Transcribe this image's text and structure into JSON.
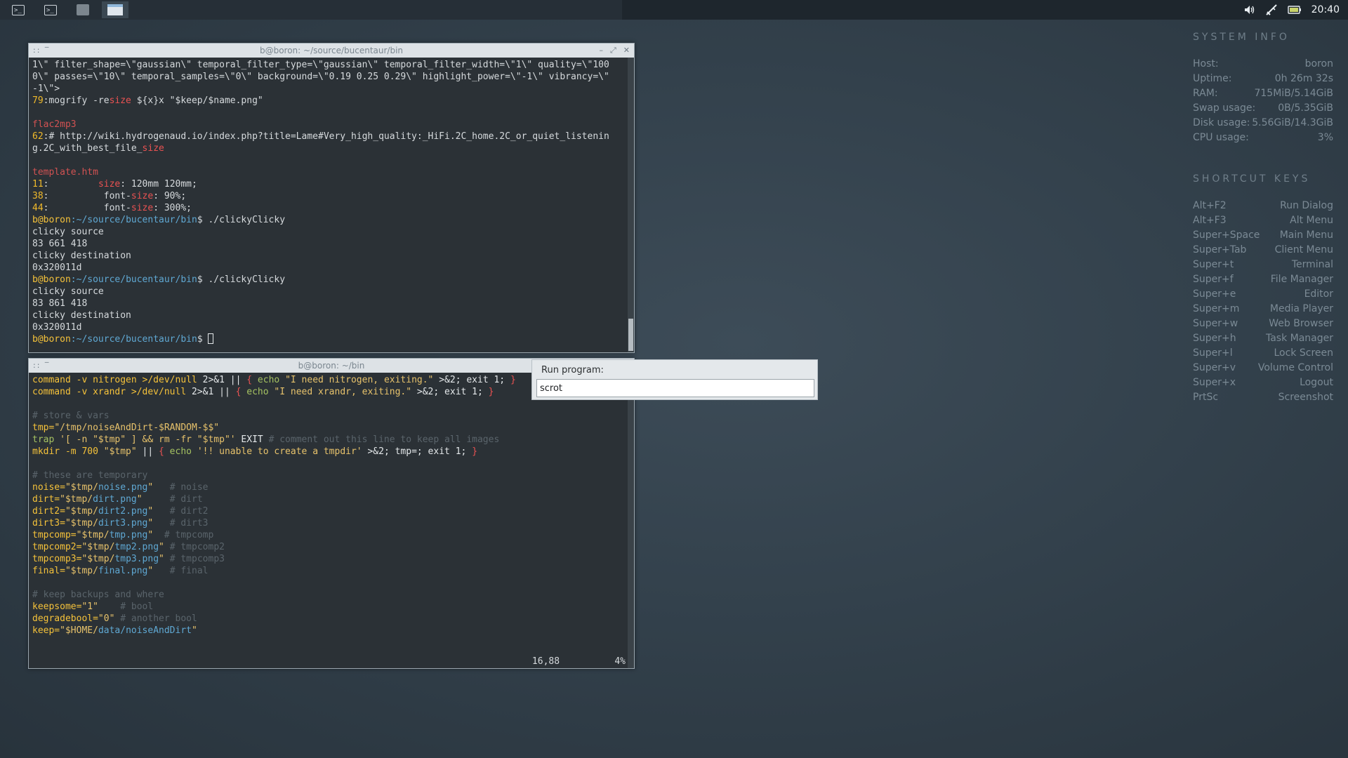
{
  "panel": {
    "taskbar_buttons": [
      {
        "name": "terminal-1",
        "glyph": ">_"
      },
      {
        "name": "terminal-2",
        "glyph": ">_"
      },
      {
        "name": "app-3",
        "glyph": ""
      },
      {
        "name": "window-4",
        "glyph": ""
      }
    ],
    "tray": {
      "volume_icon": "volume-icon",
      "network_icon": "network-icon",
      "battery_icon": "battery-icon",
      "clock": "20:40"
    }
  },
  "terminal_top": {
    "title": "b@boron: ~/source/bucentaur/bin",
    "lines": [
      {
        "segs": [
          {
            "t": "1\\\" filter_shape=\\\"gaussian\\\" temporal_filter_type=\\\"gaussian\\\" temporal_filter_width=\\\"1\\\" quality=\\\"100",
            "c": ""
          }
        ]
      },
      {
        "segs": [
          {
            "t": "0\\\" passes=\\\"10\\\" temporal_samples=\\\"0\\\" background=\\\"0.19 0.25 0.29\\\" highlight_power=\\\"-1\\\" vibrancy=\\\"",
            "c": ""
          }
        ]
      },
      {
        "segs": [
          {
            "t": "-1\\\">",
            "c": ""
          }
        ]
      },
      {
        "segs": [
          {
            "t": "79",
            "c": "c-ln"
          },
          {
            "t": ":mogrify -re",
            "c": ""
          },
          {
            "t": "size",
            "c": "c-hl"
          },
          {
            "t": " ${x}x \"$keep/$name.png\"",
            "c": ""
          }
        ]
      },
      {
        "segs": [
          {
            "t": " ",
            "c": ""
          }
        ]
      },
      {
        "segs": [
          {
            "t": "flac2mp3",
            "c": "c-file"
          }
        ]
      },
      {
        "segs": [
          {
            "t": "62",
            "c": "c-ln"
          },
          {
            "t": ":# http://wiki.hydrogenaud.io/index.php?title=Lame#Very_high_quality:_HiFi.2C_home.2C_or_quiet_listenin",
            "c": ""
          }
        ]
      },
      {
        "segs": [
          {
            "t": "g.2C_with_best_file_",
            "c": ""
          },
          {
            "t": "size",
            "c": "c-hl"
          }
        ]
      },
      {
        "segs": [
          {
            "t": " ",
            "c": ""
          }
        ]
      },
      {
        "segs": [
          {
            "t": "template.htm",
            "c": "c-file"
          }
        ]
      },
      {
        "segs": [
          {
            "t": "11",
            "c": "c-ln"
          },
          {
            "t": ":         ",
            "c": ""
          },
          {
            "t": "size",
            "c": "c-hl"
          },
          {
            "t": ": 120mm 120mm;",
            "c": ""
          }
        ]
      },
      {
        "segs": [
          {
            "t": "38",
            "c": "c-ln"
          },
          {
            "t": ":          font-",
            "c": ""
          },
          {
            "t": "size",
            "c": "c-hl"
          },
          {
            "t": ": 90%;",
            "c": ""
          }
        ]
      },
      {
        "segs": [
          {
            "t": "44",
            "c": "c-ln"
          },
          {
            "t": ":          font-",
            "c": ""
          },
          {
            "t": "size",
            "c": "c-hl"
          },
          {
            "t": ": 300%;",
            "c": ""
          }
        ]
      },
      {
        "segs": [
          {
            "t": "b@boron",
            "c": "c-user"
          },
          {
            "t": ":~/source/bucentaur/bin",
            "c": "c-path"
          },
          {
            "t": "$ ./clickyClicky",
            "c": ""
          }
        ]
      },
      {
        "segs": [
          {
            "t": "clicky source",
            "c": ""
          }
        ]
      },
      {
        "segs": [
          {
            "t": "83 661 418",
            "c": ""
          }
        ]
      },
      {
        "segs": [
          {
            "t": "clicky destination",
            "c": ""
          }
        ]
      },
      {
        "segs": [
          {
            "t": "0x320011d",
            "c": ""
          }
        ]
      },
      {
        "segs": [
          {
            "t": "b@boron",
            "c": "c-user"
          },
          {
            "t": ":~/source/bucentaur/bin",
            "c": "c-path"
          },
          {
            "t": "$ ./clickyClicky",
            "c": ""
          }
        ]
      },
      {
        "segs": [
          {
            "t": "clicky source",
            "c": ""
          }
        ]
      },
      {
        "segs": [
          {
            "t": "83 861 418",
            "c": ""
          }
        ]
      },
      {
        "segs": [
          {
            "t": "clicky destination",
            "c": ""
          }
        ]
      },
      {
        "segs": [
          {
            "t": "0x320011d",
            "c": ""
          }
        ]
      },
      {
        "segs": [
          {
            "t": "b@boron",
            "c": "c-user"
          },
          {
            "t": ":~/source/bucentaur/bin",
            "c": "c-path"
          },
          {
            "t": "$ ",
            "c": ""
          }
        ],
        "cursor": true
      }
    ]
  },
  "terminal_bottom": {
    "title": "b@boron: ~/bin",
    "lines": [
      {
        "segs": [
          {
            "t": "command -v nitrogen >/dev/null ",
            "c": "c-var"
          },
          {
            "t": "2>&1",
            "c": "c-white"
          },
          {
            "t": " || ",
            "c": "c-white"
          },
          {
            "t": "{",
            "c": "c-op"
          },
          {
            "t": " echo ",
            "c": "c-kw"
          },
          {
            "t": "\"I need nitrogen, exiting.\"",
            "c": "c-str"
          },
          {
            "t": " >&2; exit 1; ",
            "c": "c-white"
          },
          {
            "t": "}",
            "c": "c-op"
          }
        ]
      },
      {
        "segs": [
          {
            "t": "command -v xrandr >/dev/null ",
            "c": "c-var"
          },
          {
            "t": "2>&1",
            "c": "c-white"
          },
          {
            "t": " || ",
            "c": "c-white"
          },
          {
            "t": "{",
            "c": "c-op"
          },
          {
            "t": " echo ",
            "c": "c-kw"
          },
          {
            "t": "\"I need xrandr, exiting.\"",
            "c": "c-str"
          },
          {
            "t": " >&2; exit 1; ",
            "c": "c-white"
          },
          {
            "t": "}",
            "c": "c-op"
          }
        ]
      },
      {
        "segs": [
          {
            "t": " ",
            "c": ""
          }
        ]
      },
      {
        "segs": [
          {
            "t": "# store & vars",
            "c": "c-cmt"
          }
        ]
      },
      {
        "segs": [
          {
            "t": "tmp=",
            "c": "c-var"
          },
          {
            "t": "\"/tmp/noiseAndDirt-$RANDOM-$$\"",
            "c": "c-str"
          }
        ]
      },
      {
        "segs": [
          {
            "t": "trap ",
            "c": "c-kw"
          },
          {
            "t": "'[ -n \"$tmp\" ] && rm -fr \"$tmp\"'",
            "c": "c-str"
          },
          {
            "t": " EXIT ",
            "c": "c-white"
          },
          {
            "t": "# comment out this line to keep all images",
            "c": "c-cmt"
          }
        ]
      },
      {
        "segs": [
          {
            "t": "mkdir -m 700 ",
            "c": "c-var"
          },
          {
            "t": "\"$tmp\"",
            "c": "c-str"
          },
          {
            "t": " || ",
            "c": "c-white"
          },
          {
            "t": "{",
            "c": "c-op"
          },
          {
            "t": " echo ",
            "c": "c-kw"
          },
          {
            "t": "'!! unable to create a tmpdir'",
            "c": "c-str"
          },
          {
            "t": " >&2; tmp=; exit 1; ",
            "c": "c-white"
          },
          {
            "t": "}",
            "c": "c-op"
          }
        ]
      },
      {
        "segs": [
          {
            "t": " ",
            "c": ""
          }
        ]
      },
      {
        "segs": [
          {
            "t": "# these are temporary",
            "c": "c-cmt"
          }
        ]
      },
      {
        "segs": [
          {
            "t": "noise=",
            "c": "c-var"
          },
          {
            "t": "\"$tmp/",
            "c": "c-str"
          },
          {
            "t": "noise.png",
            "c": "c-blue"
          },
          {
            "t": "\"",
            "c": "c-str"
          },
          {
            "t": "   # noise",
            "c": "c-cmt"
          }
        ]
      },
      {
        "segs": [
          {
            "t": "dirt=",
            "c": "c-var"
          },
          {
            "t": "\"$tmp/",
            "c": "c-str"
          },
          {
            "t": "dirt.png",
            "c": "c-blue"
          },
          {
            "t": "\"",
            "c": "c-str"
          },
          {
            "t": "     # dirt",
            "c": "c-cmt"
          }
        ]
      },
      {
        "segs": [
          {
            "t": "dirt2=",
            "c": "c-var"
          },
          {
            "t": "\"$tmp/",
            "c": "c-str"
          },
          {
            "t": "dirt2.png",
            "c": "c-blue"
          },
          {
            "t": "\"",
            "c": "c-str"
          },
          {
            "t": "   # dirt2",
            "c": "c-cmt"
          }
        ]
      },
      {
        "segs": [
          {
            "t": "dirt3=",
            "c": "c-var"
          },
          {
            "t": "\"$tmp/",
            "c": "c-str"
          },
          {
            "t": "dirt3.png",
            "c": "c-blue"
          },
          {
            "t": "\"",
            "c": "c-str"
          },
          {
            "t": "   # dirt3",
            "c": "c-cmt"
          }
        ]
      },
      {
        "segs": [
          {
            "t": "tmpcomp=",
            "c": "c-var"
          },
          {
            "t": "\"$tmp/",
            "c": "c-str"
          },
          {
            "t": "tmp.png",
            "c": "c-blue"
          },
          {
            "t": "\"",
            "c": "c-str"
          },
          {
            "t": "  # tmpcomp",
            "c": "c-cmt"
          }
        ]
      },
      {
        "segs": [
          {
            "t": "tmpcomp2=",
            "c": "c-var"
          },
          {
            "t": "\"$tmp/",
            "c": "c-str"
          },
          {
            "t": "tmp2.png",
            "c": "c-blue"
          },
          {
            "t": "\"",
            "c": "c-str"
          },
          {
            "t": " # tmpcomp2",
            "c": "c-cmt"
          }
        ]
      },
      {
        "segs": [
          {
            "t": "tmpcomp3=",
            "c": "c-var"
          },
          {
            "t": "\"$tmp/",
            "c": "c-str"
          },
          {
            "t": "tmp3.png",
            "c": "c-blue"
          },
          {
            "t": "\"",
            "c": "c-str"
          },
          {
            "t": " # tmpcomp3",
            "c": "c-cmt"
          }
        ]
      },
      {
        "segs": [
          {
            "t": "final=",
            "c": "c-var"
          },
          {
            "t": "\"$tmp/",
            "c": "c-str"
          },
          {
            "t": "final.png",
            "c": "c-blue"
          },
          {
            "t": "\"",
            "c": "c-str"
          },
          {
            "t": "   # final",
            "c": "c-cmt"
          }
        ]
      },
      {
        "segs": [
          {
            "t": " ",
            "c": ""
          }
        ]
      },
      {
        "segs": [
          {
            "t": "# keep backups and where",
            "c": "c-cmt"
          }
        ]
      },
      {
        "segs": [
          {
            "t": "keepsome=",
            "c": "c-var"
          },
          {
            "t": "\"1\"",
            "c": "c-str"
          },
          {
            "t": "    # bool",
            "c": "c-cmt"
          }
        ]
      },
      {
        "segs": [
          {
            "t": "degradebool=",
            "c": "c-var"
          },
          {
            "t": "\"0\"",
            "c": "c-str"
          },
          {
            "t": " # another bool",
            "c": "c-cmt"
          }
        ]
      },
      {
        "segs": [
          {
            "t": "keep=",
            "c": "c-var"
          },
          {
            "t": "\"$HOME/",
            "c": "c-str"
          },
          {
            "t": "data/noiseAndDirt",
            "c": "c-blue"
          },
          {
            "t": "\"",
            "c": "c-str"
          }
        ]
      }
    ],
    "status_position": "16,88",
    "status_percent": "4%"
  },
  "run_dialog": {
    "label": "Run program:",
    "value": "scrot"
  },
  "conky": {
    "system_info_title": "SYSTEM INFO",
    "system_info": [
      {
        "k": "Host:",
        "v": "boron"
      },
      {
        "k": "Uptime:",
        "v": "0h 26m 32s"
      },
      {
        "k": "RAM:",
        "v": "715MiB/5.14GiB"
      },
      {
        "k": "Swap usage:",
        "v": "0B/5.35GiB"
      },
      {
        "k": "Disk usage:",
        "v": "5.56GiB/14.3GiB"
      },
      {
        "k": "CPU usage:",
        "v": "3%"
      }
    ],
    "shortcut_keys_title": "SHORTCUT KEYS",
    "shortcut_keys": [
      {
        "k": "Alt+F2",
        "v": "Run Dialog"
      },
      {
        "k": "Alt+F3",
        "v": "Alt Menu"
      },
      {
        "k": "Super+Space",
        "v": "Main Menu"
      },
      {
        "k": "Super+Tab",
        "v": "Client Menu"
      },
      {
        "k": "Super+t",
        "v": "Terminal"
      },
      {
        "k": "Super+f",
        "v": "File Manager"
      },
      {
        "k": "Super+e",
        "v": "Editor"
      },
      {
        "k": "Super+m",
        "v": "Media Player"
      },
      {
        "k": "Super+w",
        "v": "Web Browser"
      },
      {
        "k": "Super+h",
        "v": "Task Manager"
      },
      {
        "k": "Super+l",
        "v": "Lock Screen"
      },
      {
        "k": "Super+v",
        "v": "Volume Control"
      },
      {
        "k": "Super+x",
        "v": "Logout"
      },
      {
        "k": "PrtSc",
        "v": "Screenshot"
      }
    ]
  }
}
